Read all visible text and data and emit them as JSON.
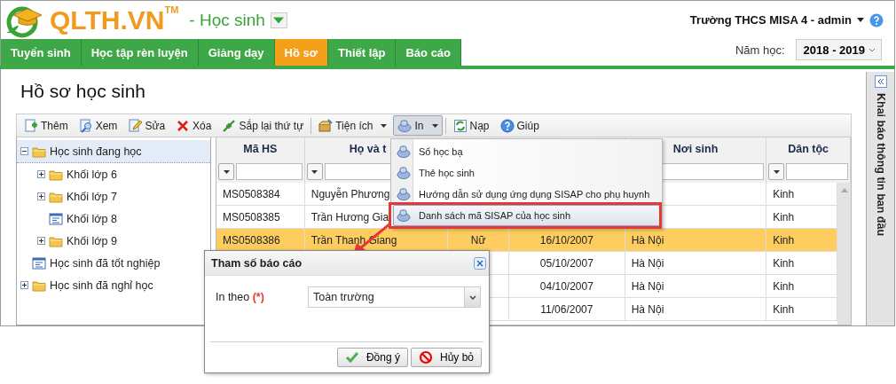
{
  "header": {
    "logo": "QLTH.VN",
    "trademark": "TM",
    "module": "- Học sinh",
    "account": "Trường THCS MISA 4 - admin"
  },
  "nav": {
    "tabs": [
      {
        "label": "Tuyển sinh",
        "selected": false
      },
      {
        "label": "Học tập rèn luyện",
        "selected": false
      },
      {
        "label": "Giảng dạy",
        "selected": false
      },
      {
        "label": "Hồ sơ",
        "selected": true
      },
      {
        "label": "Thiết lập",
        "selected": false
      },
      {
        "label": "Báo cáo",
        "selected": false
      }
    ],
    "year_label": "Năm học:",
    "year": "2018 - 2019"
  },
  "page": {
    "title": "Hồ sơ học sinh"
  },
  "toolbar": [
    {
      "label": "Thêm",
      "kind": "add",
      "dropdown": false,
      "pressed": false,
      "separator_before": false
    },
    {
      "label": "Xem",
      "kind": "view",
      "dropdown": false,
      "pressed": false,
      "separator_before": false
    },
    {
      "label": "Sửa",
      "kind": "edit",
      "dropdown": false,
      "pressed": false,
      "separator_before": false
    },
    {
      "label": "Xóa",
      "kind": "delete",
      "dropdown": false,
      "pressed": false,
      "separator_before": false
    },
    {
      "label": "Sắp lại thứ tự",
      "kind": "sort",
      "dropdown": false,
      "pressed": false,
      "separator_before": false
    },
    {
      "label": "Tiện ích",
      "kind": "tools",
      "dropdown": true,
      "pressed": false,
      "separator_before": true
    },
    {
      "label": "In",
      "kind": "print",
      "dropdown": true,
      "pressed": true,
      "separator_before": false
    },
    {
      "label": "Nạp",
      "kind": "reload",
      "dropdown": false,
      "pressed": false,
      "separator_before": true
    },
    {
      "label": "Giúp",
      "kind": "help",
      "dropdown": false,
      "pressed": false,
      "separator_before": false
    }
  ],
  "tree": [
    {
      "label": "Học sinh đang học",
      "kind": "folder",
      "expanded": true,
      "selected": true,
      "children": [
        {
          "label": "Khối lớp 6",
          "kind": "folder",
          "expanded": false,
          "selected": false
        },
        {
          "label": "Khối lớp 7",
          "kind": "folder",
          "expanded": false,
          "selected": false
        },
        {
          "label": "Khối lớp 8",
          "kind": "list",
          "selected": false
        },
        {
          "label": "Khối lớp 9",
          "kind": "folder",
          "expanded": false,
          "selected": false
        }
      ]
    },
    {
      "label": "Học sinh đã tốt nghiệp",
      "kind": "list",
      "selected": false
    },
    {
      "label": "Học sinh đã nghỉ học",
      "kind": "folder",
      "expanded": false,
      "selected": false
    }
  ],
  "grid": {
    "columns": [
      "Mã HS",
      "Họ và t",
      null,
      null,
      "Nơi sinh",
      "Dân tộc"
    ],
    "rows": [
      {
        "cells": [
          "MS0508384",
          "Nguyễn Phương",
          null,
          null,
          null,
          "Kinh"
        ],
        "selected": false
      },
      {
        "cells": [
          "MS0508385",
          "Trần Hương Gia",
          null,
          null,
          null,
          "Kinh"
        ],
        "selected": false
      },
      {
        "cells": [
          "MS0508386",
          "Trần Thanh Giang",
          "Nữ",
          "16/10/2007",
          "Hà Nội",
          "Kinh"
        ],
        "selected": true
      },
      {
        "cells": [
          null,
          null,
          null,
          "05/10/2007",
          "Hà Nội",
          "Kinh"
        ],
        "selected": false
      },
      {
        "cells": [
          null,
          null,
          null,
          "04/10/2007",
          "Hà Nội",
          "Kinh"
        ],
        "selected": false
      },
      {
        "cells": [
          null,
          null,
          null,
          "11/06/2007",
          "Hà Nội",
          "Kinh"
        ],
        "selected": false
      }
    ]
  },
  "side_panel": {
    "title": "Khai báo thông tin ban đầu"
  },
  "menu": {
    "items": [
      {
        "label": "Sổ học bạ",
        "selected": false
      },
      {
        "label": "Thẻ học sinh",
        "selected": false
      },
      {
        "label": "Hướng dẫn sử dụng ứng dụng SISAP cho phụ huynh",
        "selected": false
      },
      {
        "label": "Danh sách mã SISAP của học sinh",
        "selected": true
      }
    ]
  },
  "dialog": {
    "title": "Tham số báo cáo",
    "field": {
      "label": "In theo",
      "required_mark": "(*)",
      "value": "Toàn trường"
    },
    "buttons": [
      {
        "label": "Đồng ý",
        "kind": "ok"
      },
      {
        "label": "Hủy bỏ",
        "kind": "cancel"
      }
    ]
  }
}
